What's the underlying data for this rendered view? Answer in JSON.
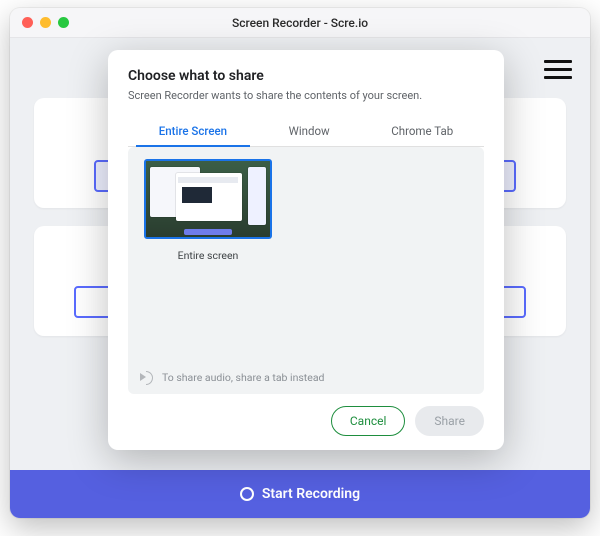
{
  "window": {
    "title": "Screen Recorder - Scre.io"
  },
  "footer": {
    "start_label": "Start Recording"
  },
  "dialog": {
    "title": "Choose what to share",
    "subtitle": "Screen Recorder wants to share the contents of your screen.",
    "tabs": {
      "entire": "Entire Screen",
      "window": "Window",
      "chrome": "Chrome Tab"
    },
    "thumb_label": "Entire screen",
    "audio_hint": "To share audio, share a tab instead",
    "cancel": "Cancel",
    "share": "Share"
  }
}
